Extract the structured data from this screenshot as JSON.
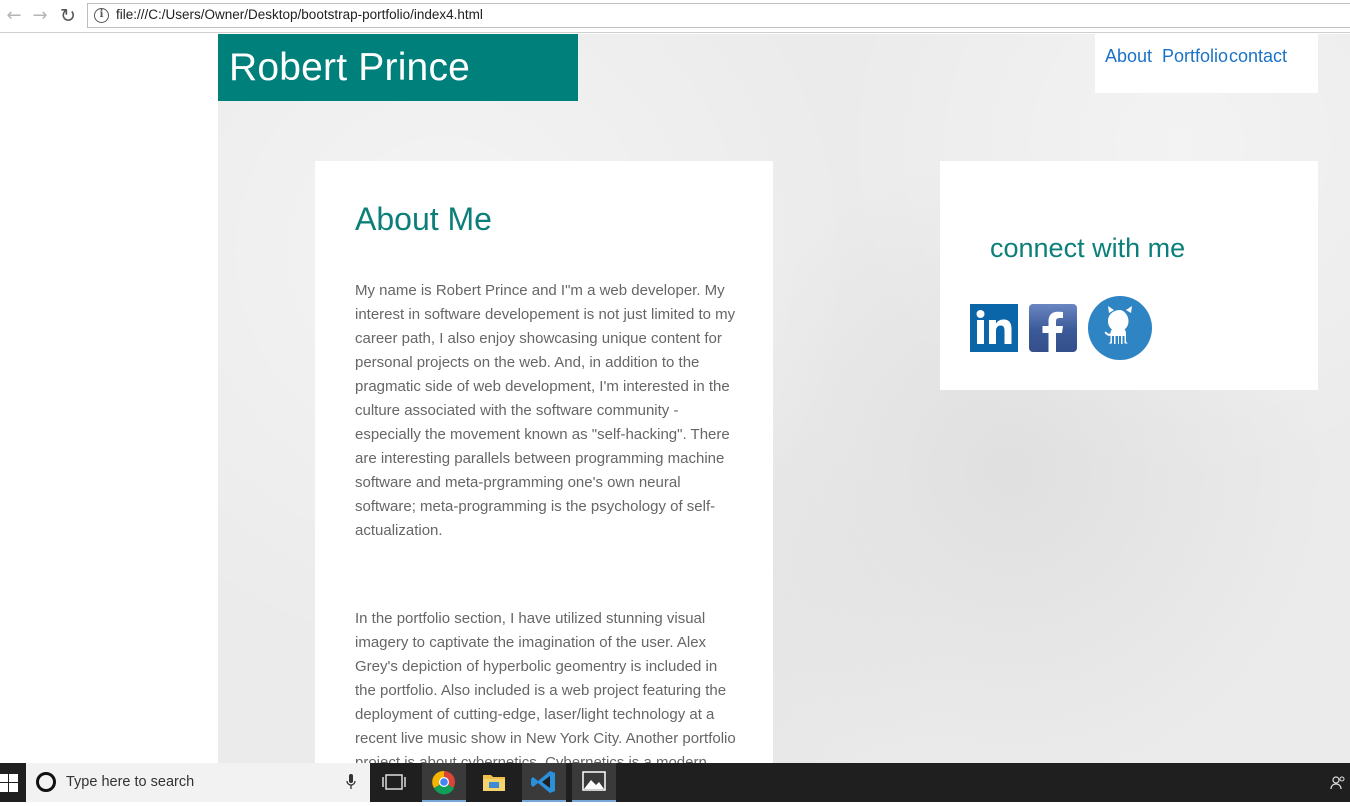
{
  "browser": {
    "url": "file:///C:/Users/Owner/Desktop/bootstrap-portfolio/index4.html"
  },
  "site": {
    "brand": "Robert Prince",
    "nav": [
      {
        "label": "About"
      },
      {
        "label": "Portfolio"
      },
      {
        "label": "contact"
      }
    ]
  },
  "about": {
    "title": "About Me",
    "paragraphs": [
      "My name is Robert Prince and I\"m a web developer. My interest in software developement is not just limited to my career path, I also enjoy showcasing unique content for personal projects on the web. And, in addition to the pragmatic side of web development, I'm interested in the culture associated with the software community - especially the movement known as \"self-hacking\". There are interesting parallels between programming machine software and meta-prgramming one's own neural software; meta-programming is the psychology of self-actualization.",
      "In the portfolio section, I have utilized stunning visual imagery to captivate the imagination of the user. Alex Grey's depiction of hyperbolic geomentry is included in the portfolio. Also included is a web project featuring the deployment of cutting-edge, laser/light technology at a recent live music show in New York City. Another portfolio project is about cybernetics. Cybernetics is a modern technology of"
    ]
  },
  "connect": {
    "title": "connect with me",
    "icons": [
      "linkedin-icon",
      "facebook-icon",
      "github-icon"
    ]
  },
  "taskbar": {
    "search_placeholder": "Type here to search"
  },
  "colors": {
    "brand_teal": "#00807a",
    "heading_teal": "#0d7f7a",
    "link_blue": "#1a73c7",
    "body_text": "#666666"
  }
}
